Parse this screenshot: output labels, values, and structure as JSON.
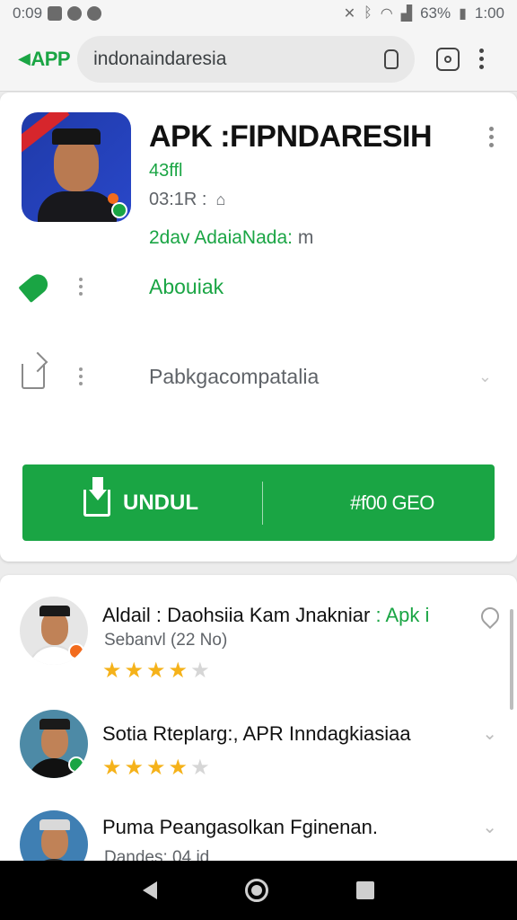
{
  "status_bar": {
    "time": "0:09",
    "battery": "63%",
    "clock_right": "1:00"
  },
  "browser": {
    "brand": "APP",
    "url": "indonaindaresia"
  },
  "app": {
    "title": "APK :FIPNDARESIH",
    "version": "43ffl",
    "size": "03:1R :",
    "desc_green": "2dav AdaiaNada:",
    "desc_gray": "m",
    "row1_label": "Abouiak",
    "row2_label": "Pabkgacompatalia",
    "download_label": "UNDUL",
    "download_size": "#f00 GEO"
  },
  "related": [
    {
      "title": "Aldail : Daohsiia Kam Jnakniar ",
      "title_green": ": Apk i",
      "sub": "Sebanvl (22 No)",
      "rating": 4
    },
    {
      "title": "Sotia Rteplarg:, APR Inndagkiasiaa",
      "title_green": "",
      "sub": "",
      "rating": 4
    },
    {
      "title": "Puma Peangasolkan Fginenan.",
      "title_green": "",
      "sub": "Dandes: 04 id",
      "rating": 0
    }
  ],
  "colors": {
    "accent_green": "#1aa544",
    "star": "#f5b21a"
  },
  "icons": [
    "signal-icon",
    "bluetooth-icon",
    "wifi-icon",
    "battery-icon",
    "lock-icon",
    "tabs-icon",
    "menu-icon",
    "tag-icon",
    "share-icon",
    "download-icon",
    "back-icon",
    "home-icon",
    "recents-icon"
  ]
}
